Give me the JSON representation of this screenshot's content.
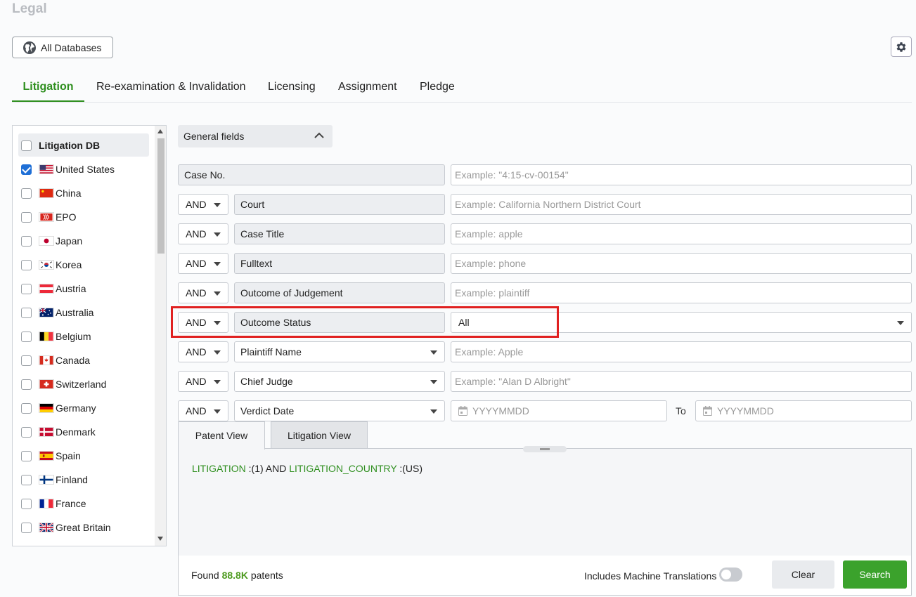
{
  "page": {
    "title": "Legal"
  },
  "toolbar": {
    "databases_label": "All Databases"
  },
  "tabs": [
    {
      "label": "Litigation",
      "active": true
    },
    {
      "label": "Re-examination & Invalidation"
    },
    {
      "label": "Licensing"
    },
    {
      "label": "Assignment"
    },
    {
      "label": "Pledge"
    }
  ],
  "db_panel": {
    "header": "Litigation DB",
    "items": [
      {
        "label": "United States",
        "checked": true
      },
      {
        "label": "China"
      },
      {
        "label": "EPO"
      },
      {
        "label": "Japan"
      },
      {
        "label": "Korea"
      },
      {
        "label": "Austria"
      },
      {
        "label": "Australia"
      },
      {
        "label": "Belgium"
      },
      {
        "label": "Canada"
      },
      {
        "label": "Switzerland"
      },
      {
        "label": "Germany"
      },
      {
        "label": "Denmark"
      },
      {
        "label": "Spain"
      },
      {
        "label": "Finland"
      },
      {
        "label": "France"
      },
      {
        "label": "Great Britain"
      }
    ]
  },
  "general_fields": {
    "label": "General fields"
  },
  "rows": [
    {
      "field": "Case No.",
      "placeholder": "Example: \"4:15-cv-00154\""
    },
    {
      "op": "AND",
      "field": "Court",
      "placeholder": "Example: California Northern District Court"
    },
    {
      "op": "AND",
      "field": "Case Title",
      "placeholder": "Example: apple"
    },
    {
      "op": "AND",
      "field": "Fulltext",
      "placeholder": "Example: phone"
    },
    {
      "op": "AND",
      "field": "Outcome of Judgement",
      "placeholder": "Example: plaintiff"
    },
    {
      "op": "AND",
      "field": "Outcome Status",
      "value": "All"
    },
    {
      "op": "AND",
      "field": "Plaintiff Name",
      "placeholder": "Example: Apple"
    },
    {
      "op": "AND",
      "field": "Chief Judge",
      "placeholder": "Example: \"Alan D Albright\""
    },
    {
      "op": "AND",
      "field": "Verdict Date",
      "from_placeholder": "YYYYMMDD",
      "to_label": "To",
      "to_placeholder": "YYYYMMDD"
    }
  ],
  "view_tabs": [
    {
      "label": "Patent View",
      "active": true
    },
    {
      "label": "Litigation View"
    }
  ],
  "query": {
    "field1": "LITIGATION",
    "value1": ":(1) AND",
    "field2": "LITIGATION_COUNTRY",
    "value2": ":(US)"
  },
  "footer": {
    "found_prefix": "Found",
    "found_count": "88.8K",
    "found_suffix": "patents",
    "machine_translations_label": "Includes Machine Translations",
    "clear_label": "Clear",
    "search_label": "Search"
  },
  "colors": {
    "accent": "#2f8f1f",
    "search_button": "#3ba22c",
    "highlight": "#e02020",
    "checkbox": "#1f6fd6"
  }
}
